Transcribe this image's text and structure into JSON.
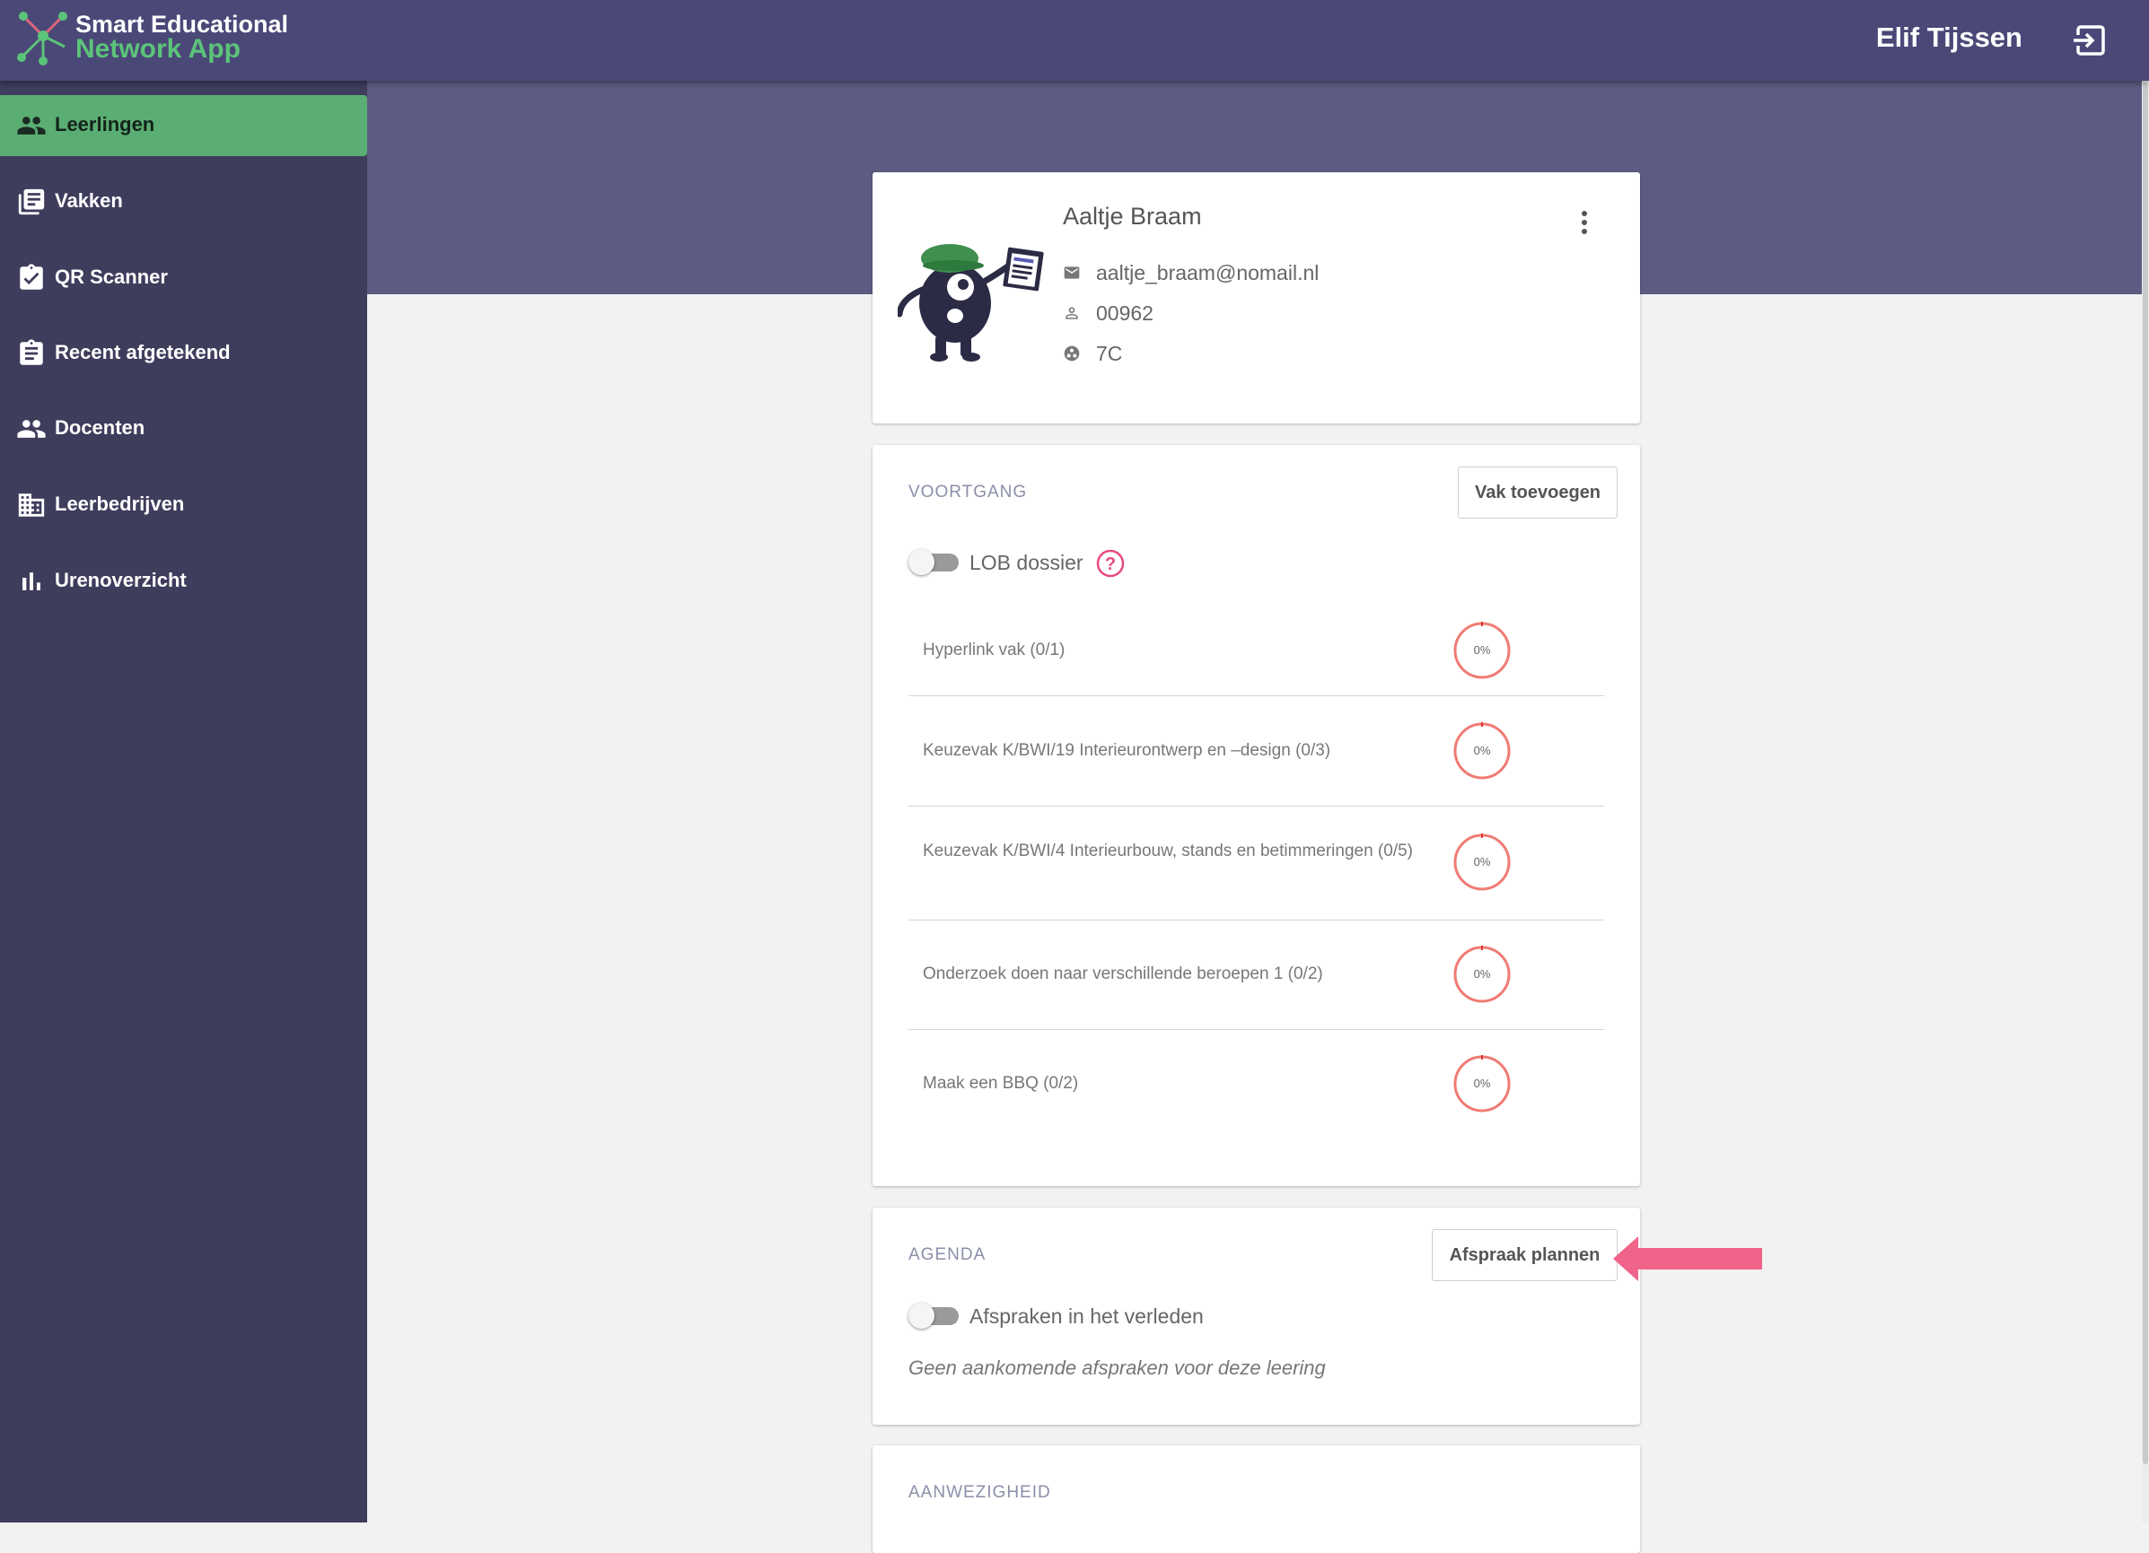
{
  "app": {
    "logo_line1": "Smart Educational",
    "logo_line2": "Network App",
    "user_name": "Elif Tijssen"
  },
  "colors": {
    "topbar": "#4a4877",
    "sidebar": "#3f3d5c",
    "active_item": "#5aae73",
    "brand_green": "#5cc47a",
    "ring_red": "#f07b73",
    "arrow_pink": "#f0648a"
  },
  "sidebar": {
    "items": [
      {
        "label": "Leerlingen",
        "icon": "people-icon",
        "active": true
      },
      {
        "label": "Vakken",
        "icon": "library-books-icon"
      },
      {
        "label": "QR Scanner",
        "icon": "clipboard-check-icon"
      },
      {
        "label": "Recent afgetekend",
        "icon": "clipboard-list-icon"
      },
      {
        "label": "Docenten",
        "icon": "people-icon"
      },
      {
        "label": "Leerbedrijven",
        "icon": "building-icon"
      },
      {
        "label": "Urenoverzicht",
        "icon": "bar-chart-icon"
      }
    ]
  },
  "student": {
    "name": "Aaltje Braam",
    "email": "aaltje_braam@nomail.nl",
    "number": "00962",
    "class": "7C"
  },
  "voortgang": {
    "title": "VOORTGANG",
    "add_button": "Vak toevoegen",
    "toggle_label": "LOB dossier",
    "toggle_on": false,
    "items": [
      {
        "label": "Hyperlink vak (0/1)",
        "percent": "0%",
        "progress": 0
      },
      {
        "label": "Keuzevak K/BWI/19 Interieurontwerp en –design (0/3)",
        "percent": "0%",
        "progress": 0
      },
      {
        "label": "Keuzevak K/BWI/4 Interieurbouw, stands en betimmeringen (0/5)",
        "percent": "0%",
        "progress": 0
      },
      {
        "label": "Onderzoek doen naar verschillende beroepen 1 (0/2)",
        "percent": "0%",
        "progress": 0
      },
      {
        "label": "Maak een BBQ (0/2)",
        "percent": "0%",
        "progress": 0
      }
    ]
  },
  "agenda": {
    "title": "AGENDA",
    "plan_button": "Afspraak plannen",
    "toggle_label": "Afspraken in het verleden",
    "toggle_on": false,
    "empty_text": "Geen aankomende afspraken voor deze leering"
  },
  "aanwezigheid": {
    "title": "AANWEZIGHEID"
  }
}
